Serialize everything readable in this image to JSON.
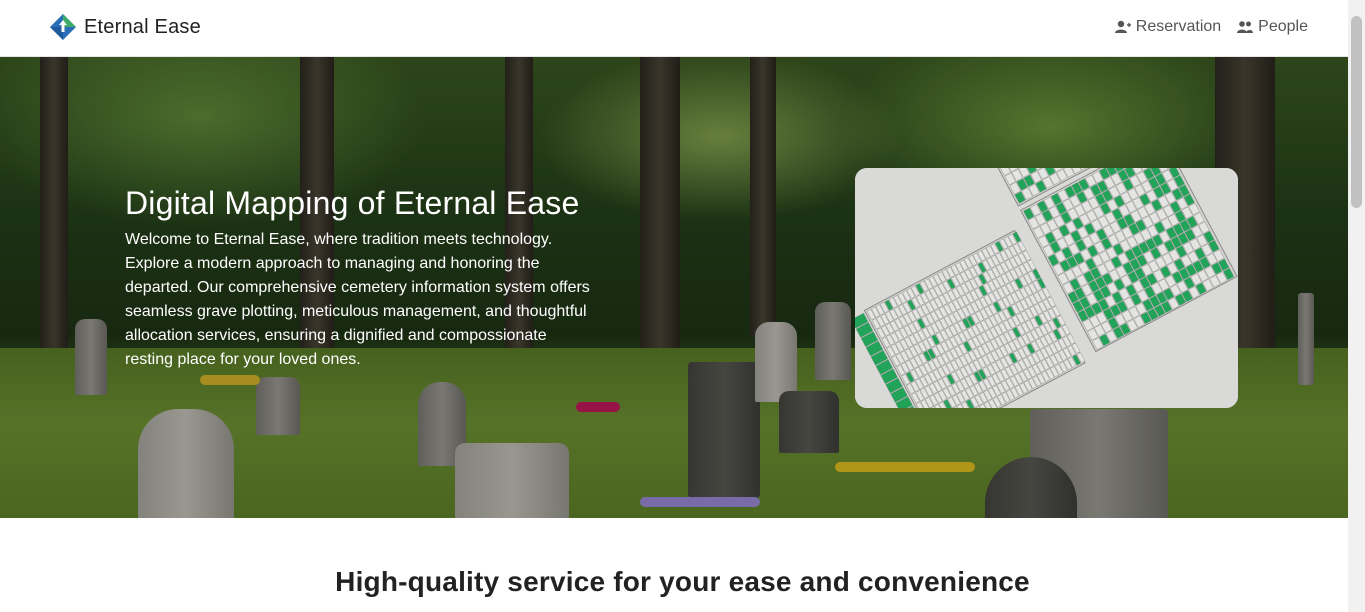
{
  "brand": {
    "name": "Eternal Ease",
    "logo_icon": "diamond-arrow-logo-icon"
  },
  "nav": {
    "items": [
      {
        "label": "Reservation",
        "icon": "user-plus-icon"
      },
      {
        "label": "People",
        "icon": "users-icon"
      }
    ]
  },
  "hero": {
    "title": "Digital Mapping of Eternal Ease",
    "description": "Welcome to Eternal Ease, where tradition meets technology. Explore a modern approach to managing and honoring the departed. Our comprehensive cemetery information system offers seamless grave plotting, meticulous management, and thoughtful allocation services, ensuring a dignified and compossionate resting place for your loved ones.",
    "map_image": "cemetery-map-image"
  },
  "section": {
    "title": "High-quality service for your ease and convenience"
  },
  "colors": {
    "accent_green": "#22a35a",
    "logo_blue": "#2a6fb8",
    "text_dark": "#222222"
  }
}
